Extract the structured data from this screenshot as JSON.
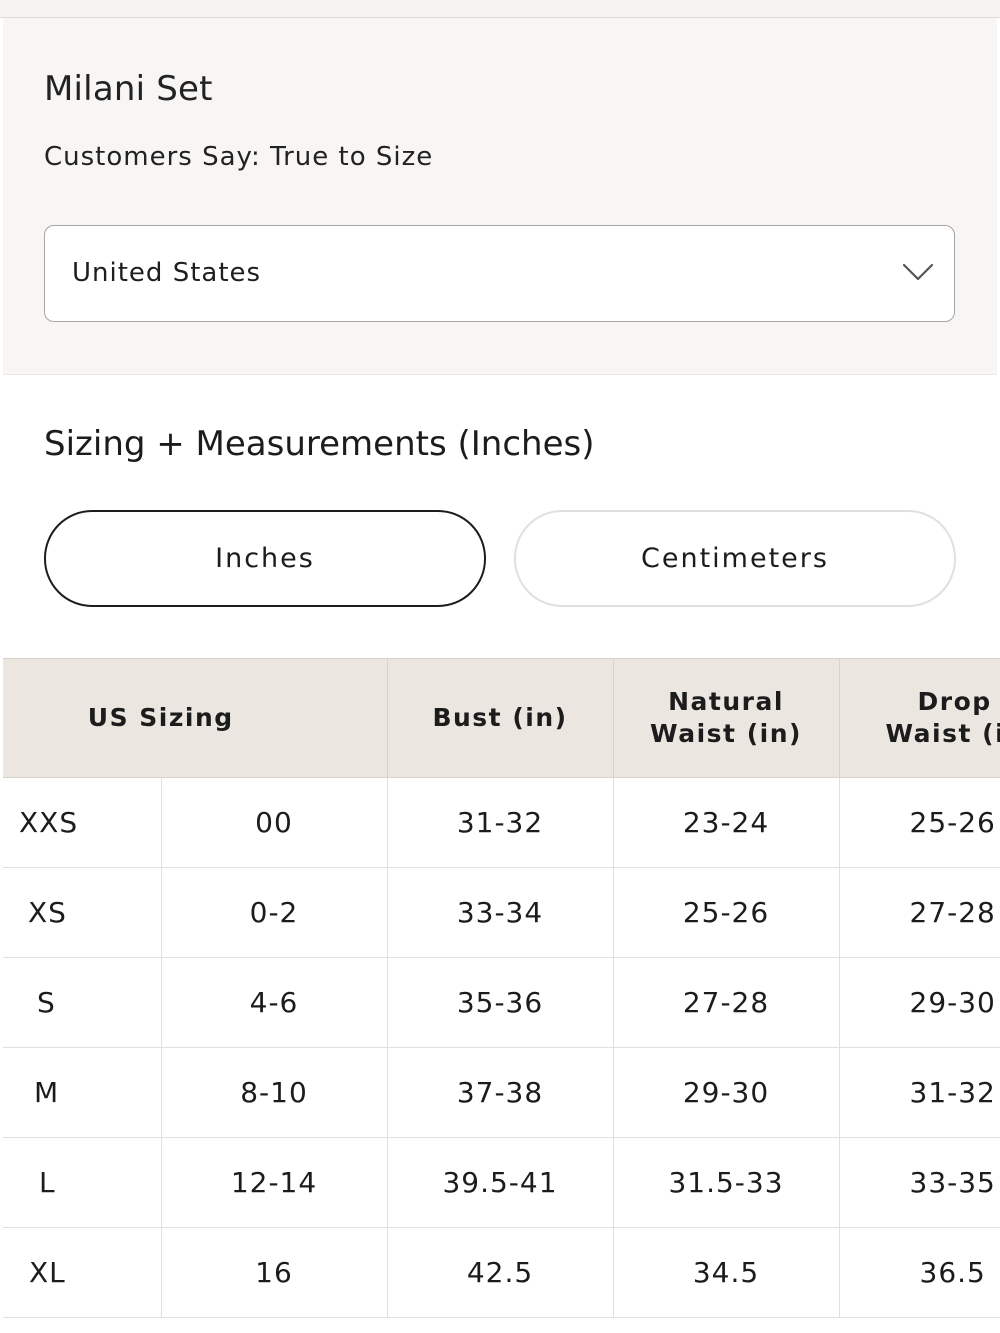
{
  "product": {
    "title": "Milani Set",
    "fit_note": "Customers Say: True to Size"
  },
  "country_select": {
    "value": "United States",
    "icon": "chevron-down-icon"
  },
  "sizing": {
    "heading": "Sizing + Measurements (Inches)",
    "units": [
      {
        "label": "Inches",
        "selected": true
      },
      {
        "label": "Centimeters",
        "selected": false
      }
    ]
  },
  "table": {
    "headers": {
      "us_sizing": "US Sizing",
      "bust": "Bust (in)",
      "natural_waist_line1": "Natural",
      "natural_waist_line2": "Waist (in)",
      "drop_waist_line1": "Drop",
      "drop_waist_line2": "Waist (in"
    },
    "rows": [
      {
        "letter": "XXS",
        "number": "00",
        "bust": "31-32",
        "natural_waist": "23-24",
        "drop_waist": "25-26"
      },
      {
        "letter": "XS",
        "number": "0-2",
        "bust": "33-34",
        "natural_waist": "25-26",
        "drop_waist": "27-28"
      },
      {
        "letter": "S",
        "number": "4-6",
        "bust": "35-36",
        "natural_waist": "27-28",
        "drop_waist": "29-30"
      },
      {
        "letter": "M",
        "number": "8-10",
        "bust": "37-38",
        "natural_waist": "29-30",
        "drop_waist": "31-32"
      },
      {
        "letter": "L",
        "number": "12-14",
        "bust": "39.5-41",
        "natural_waist": "31.5-33",
        "drop_waist": "33-35"
      },
      {
        "letter": "XL",
        "number": "16",
        "bust": "42.5",
        "natural_waist": "34.5",
        "drop_waist": "36.5"
      }
    ]
  }
}
